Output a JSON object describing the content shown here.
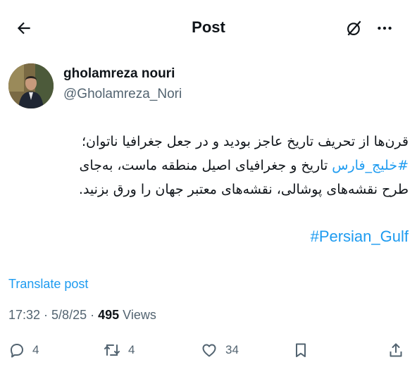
{
  "header": {
    "title": "Post",
    "back_icon": "arrow-left-icon",
    "grok_icon": "grok-icon",
    "more_icon": "more-horizontal-icon"
  },
  "author": {
    "name": "gholamreza nouri",
    "handle": "@Gholamreza_Nori"
  },
  "tweet": {
    "line1": "قرن‌ها از تحریف تاریخ عاجز بودید و در جعل جغرافیا ناتوان؛",
    "line2_hashtag": "#خلیج_فارس",
    "line2_text": " تاریخ و جغرافیای اصیل منطقه ماست، به‌جای",
    "line3": "طرح نقشه‌های پوشالی، نقشه‌های معتبر جهان را ورق بزنید.",
    "hashtag_en": "#Persian_Gulf"
  },
  "translate_label": "Translate post",
  "meta": {
    "time": "17:32",
    "separator": " · ",
    "date": "5/8/25",
    "views_count": "495",
    "views_label": " Views"
  },
  "actions": {
    "reply_count": "4",
    "retweet_count": "4",
    "like_count": "34"
  },
  "colors": {
    "accent": "#1d9bf0",
    "text": "#0f1419",
    "secondary": "#536471"
  }
}
